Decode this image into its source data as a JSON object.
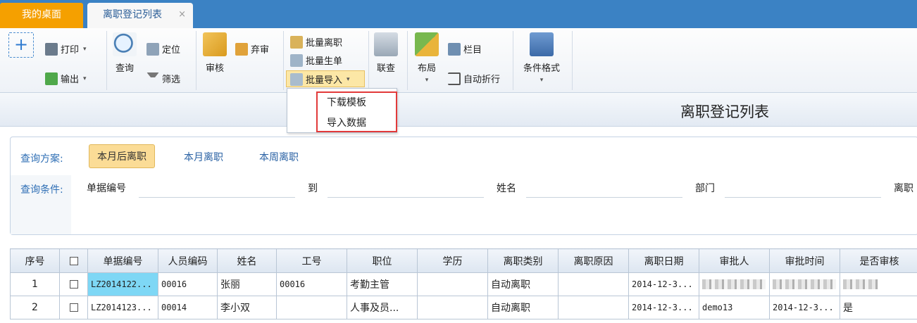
{
  "tabs": {
    "home": "我的桌面",
    "active": "离职登记列表",
    "close": "×"
  },
  "ribbon": {
    "add": "+",
    "print": "打印",
    "export": "输出",
    "query": "查询",
    "locate": "定位",
    "filter": "筛选",
    "audit": "审核",
    "abandon": "弃审",
    "batch_resign": "批量离职",
    "batch_generate": "批量生单",
    "batch_import": "批量导入",
    "link_query": "联查",
    "layout": "布局",
    "columns": "栏目",
    "auto_wrap": "自动折行",
    "cond_format": "条件格式",
    "caret": "▾"
  },
  "dropdown": {
    "download_template": "下载模板",
    "import_data": "导入数据"
  },
  "page_title": "离职登记列表",
  "query": {
    "scheme_label": "查询方案:",
    "schemes": [
      "本月后离职",
      "本月离职",
      "本周离职"
    ],
    "cond_label": "查询条件:",
    "doc_no": "单据编号",
    "to": "到",
    "name": "姓名",
    "dept": "部门",
    "resign_cut": "离职"
  },
  "grid": {
    "columns": [
      "序号",
      "",
      "单据编号",
      "人员编码",
      "姓名",
      "工号",
      "职位",
      "学历",
      "离职类别",
      "离职原因",
      "离职日期",
      "审批人",
      "审批时间",
      "是否审核"
    ],
    "rows": [
      {
        "seq": "1",
        "doc_no": "LZ2014122...",
        "emp_code": "00016",
        "name": "张丽",
        "work_no": "00016",
        "position": "考勤主管",
        "education": "",
        "category": "自动离职",
        "reason": "",
        "date": "2014-12-3...",
        "approver": "",
        "approve_time": "",
        "audited": ""
      },
      {
        "seq": "2",
        "doc_no": "LZ2014123...",
        "emp_code": "00014",
        "name": "李小双",
        "work_no": "",
        "position": "人事及员...",
        "education": "",
        "category": "自动离职",
        "reason": "",
        "date": "2014-12-3...",
        "approver": "demo13",
        "approve_time": "2014-12-3...",
        "audited": "是"
      }
    ]
  }
}
